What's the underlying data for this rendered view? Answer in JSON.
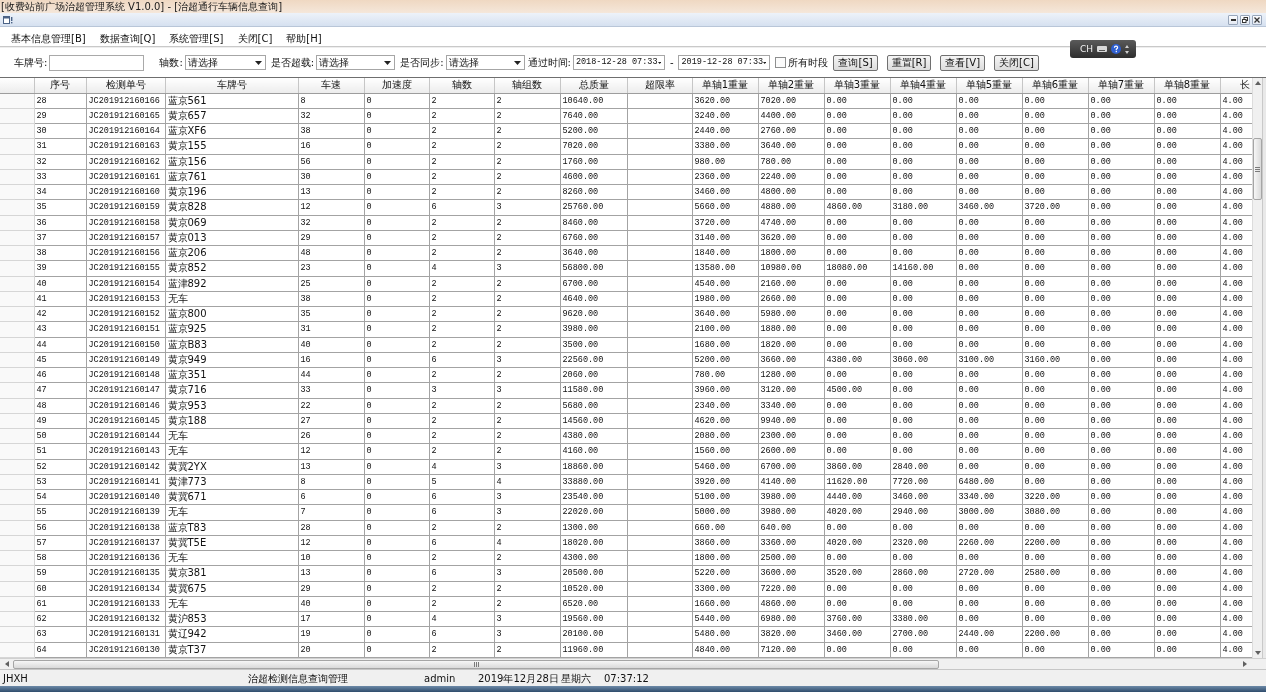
{
  "window": {
    "title": "[收费站前广场治超管理系统 V1.0.0] - [治超通行车辆信息查询]"
  },
  "menu": [
    "基本信息管理[B]",
    "数据查询[Q]",
    "系统管理[S]",
    "关闭[C]",
    "帮助[H]"
  ],
  "filters": {
    "plate_number": {
      "label": "车牌号:"
    },
    "dropdowns": [
      {
        "label": "轴数:",
        "value": "请选择"
      },
      {
        "label": "是否超载:",
        "value": "请选择"
      },
      {
        "label": "是否同步:",
        "value": "请选择"
      }
    ],
    "pass_time": {
      "label": "通过时间:",
      "from": "2018-12-28 07:33",
      "separator": "-",
      "to": "2019-12-28 07:33"
    },
    "all_periods": {
      "label": "所有时段",
      "checked": false
    },
    "buttons": [
      "查询[S]",
      "重置[R]",
      "查看[V]",
      "关闭[C]"
    ]
  },
  "language_bar": {
    "label": "CH"
  },
  "table": {
    "columns": [
      "序号",
      "检测单号",
      "车牌号",
      "车速",
      "加速度",
      "轴数",
      "轴组数",
      "总质量",
      "超限率",
      "单轴1重量",
      "单轴2重量",
      "单轴3重量",
      "单轴4重量",
      "单轴5重量",
      "单轴6重量",
      "单轴7重量",
      "单轴8重量",
      "长"
    ],
    "rows": [
      {
        "no": "28",
        "code": "JC201912160166",
        "plate": "蓝京561",
        "speed": "8",
        "accel": "0",
        "axles": "2",
        "axle_groups": "2",
        "total": "10640.00",
        "axle_weights": [
          "3620.00",
          "7020.00",
          "0.00",
          "0.00",
          "0.00",
          "0.00",
          "0.00",
          "0.00"
        ],
        "length": "4.00"
      },
      {
        "no": "29",
        "code": "JC201912160165",
        "plate": "黄京657",
        "speed": "32",
        "accel": "0",
        "axles": "2",
        "axle_groups": "2",
        "total": "7640.00",
        "axle_weights": [
          "3240.00",
          "4400.00",
          "0.00",
          "0.00",
          "0.00",
          "0.00",
          "0.00",
          "0.00"
        ],
        "length": "4.00"
      },
      {
        "no": "30",
        "code": "JC201912160164",
        "plate": "蓝京XF6",
        "speed": "38",
        "accel": "0",
        "axles": "2",
        "axle_groups": "2",
        "total": "5200.00",
        "axle_weights": [
          "2440.00",
          "2760.00",
          "0.00",
          "0.00",
          "0.00",
          "0.00",
          "0.00",
          "0.00"
        ],
        "length": "4.00"
      },
      {
        "no": "31",
        "code": "JC201912160163",
        "plate": "黄京155",
        "speed": "16",
        "accel": "0",
        "axles": "2",
        "axle_groups": "2",
        "total": "7020.00",
        "axle_weights": [
          "3380.00",
          "3640.00",
          "0.00",
          "0.00",
          "0.00",
          "0.00",
          "0.00",
          "0.00"
        ],
        "length": "4.00"
      },
      {
        "no": "32",
        "code": "JC201912160162",
        "plate": "蓝京156",
        "speed": "56",
        "accel": "0",
        "axles": "2",
        "axle_groups": "2",
        "total": "1760.00",
        "axle_weights": [
          "980.00",
          "780.00",
          "0.00",
          "0.00",
          "0.00",
          "0.00",
          "0.00",
          "0.00"
        ],
        "length": "4.00"
      },
      {
        "no": "33",
        "code": "JC201912160161",
        "plate": "蓝京761",
        "speed": "30",
        "accel": "0",
        "axles": "2",
        "axle_groups": "2",
        "total": "4600.00",
        "axle_weights": [
          "2360.00",
          "2240.00",
          "0.00",
          "0.00",
          "0.00",
          "0.00",
          "0.00",
          "0.00"
        ],
        "length": "4.00"
      },
      {
        "no": "34",
        "code": "JC201912160160",
        "plate": "黄京196",
        "speed": "13",
        "accel": "0",
        "axles": "2",
        "axle_groups": "2",
        "total": "8260.00",
        "axle_weights": [
          "3460.00",
          "4800.00",
          "0.00",
          "0.00",
          "0.00",
          "0.00",
          "0.00",
          "0.00"
        ],
        "length": "4.00"
      },
      {
        "no": "35",
        "code": "JC201912160159",
        "plate": "黄京828",
        "speed": "12",
        "accel": "0",
        "axles": "6",
        "axle_groups": "3",
        "total": "25760.00",
        "axle_weights": [
          "5660.00",
          "4880.00",
          "4860.00",
          "3180.00",
          "3460.00",
          "3720.00",
          "0.00",
          "0.00"
        ],
        "length": "4.00"
      },
      {
        "no": "36",
        "code": "JC201912160158",
        "plate": "黄京069",
        "speed": "32",
        "accel": "0",
        "axles": "2",
        "axle_groups": "2",
        "total": "8460.00",
        "axle_weights": [
          "3720.00",
          "4740.00",
          "0.00",
          "0.00",
          "0.00",
          "0.00",
          "0.00",
          "0.00"
        ],
        "length": "4.00"
      },
      {
        "no": "37",
        "code": "JC201912160157",
        "plate": "黄京013",
        "speed": "29",
        "accel": "0",
        "axles": "2",
        "axle_groups": "2",
        "total": "6760.00",
        "axle_weights": [
          "3140.00",
          "3620.00",
          "0.00",
          "0.00",
          "0.00",
          "0.00",
          "0.00",
          "0.00"
        ],
        "length": "4.00"
      },
      {
        "no": "38",
        "code": "JC201912160156",
        "plate": "蓝京206",
        "speed": "48",
        "accel": "0",
        "axles": "2",
        "axle_groups": "2",
        "total": "3640.00",
        "axle_weights": [
          "1840.00",
          "1800.00",
          "0.00",
          "0.00",
          "0.00",
          "0.00",
          "0.00",
          "0.00"
        ],
        "length": "4.00"
      },
      {
        "no": "39",
        "code": "JC201912160155",
        "plate": "黄京852",
        "speed": "23",
        "accel": "0",
        "axles": "4",
        "axle_groups": "3",
        "total": "56800.00",
        "axle_weights": [
          "13580.00",
          "10980.00",
          "18080.00",
          "14160.00",
          "0.00",
          "0.00",
          "0.00",
          "0.00"
        ],
        "length": "4.00"
      },
      {
        "no": "40",
        "code": "JC201912160154",
        "plate": "蓝津892",
        "speed": "25",
        "accel": "0",
        "axles": "2",
        "axle_groups": "2",
        "total": "6700.00",
        "axle_weights": [
          "4540.00",
          "2160.00",
          "0.00",
          "0.00",
          "0.00",
          "0.00",
          "0.00",
          "0.00"
        ],
        "length": "4.00"
      },
      {
        "no": "41",
        "code": "JC201912160153",
        "plate": "无车",
        "speed": "38",
        "accel": "0",
        "axles": "2",
        "axle_groups": "2",
        "total": "4640.00",
        "axle_weights": [
          "1980.00",
          "2660.00",
          "0.00",
          "0.00",
          "0.00",
          "0.00",
          "0.00",
          "0.00"
        ],
        "length": "4.00"
      },
      {
        "no": "42",
        "code": "JC201912160152",
        "plate": "蓝京800",
        "speed": "35",
        "accel": "0",
        "axles": "2",
        "axle_groups": "2",
        "total": "9620.00",
        "axle_weights": [
          "3640.00",
          "5980.00",
          "0.00",
          "0.00",
          "0.00",
          "0.00",
          "0.00",
          "0.00"
        ],
        "length": "4.00"
      },
      {
        "no": "43",
        "code": "JC201912160151",
        "plate": "蓝京925",
        "speed": "31",
        "accel": "0",
        "axles": "2",
        "axle_groups": "2",
        "total": "3980.00",
        "axle_weights": [
          "2100.00",
          "1880.00",
          "0.00",
          "0.00",
          "0.00",
          "0.00",
          "0.00",
          "0.00"
        ],
        "length": "4.00"
      },
      {
        "no": "44",
        "code": "JC201912160150",
        "plate": "蓝京B83",
        "speed": "40",
        "accel": "0",
        "axles": "2",
        "axle_groups": "2",
        "total": "3500.00",
        "axle_weights": [
          "1680.00",
          "1820.00",
          "0.00",
          "0.00",
          "0.00",
          "0.00",
          "0.00",
          "0.00"
        ],
        "length": "4.00"
      },
      {
        "no": "45",
        "code": "JC201912160149",
        "plate": "黄京949",
        "speed": "16",
        "accel": "0",
        "axles": "6",
        "axle_groups": "3",
        "total": "22560.00",
        "axle_weights": [
          "5200.00",
          "3660.00",
          "4380.00",
          "3060.00",
          "3100.00",
          "3160.00",
          "0.00",
          "0.00"
        ],
        "length": "4.00"
      },
      {
        "no": "46",
        "code": "JC201912160148",
        "plate": "蓝京351",
        "speed": "44",
        "accel": "0",
        "axles": "2",
        "axle_groups": "2",
        "total": "2060.00",
        "axle_weights": [
          "780.00",
          "1280.00",
          "0.00",
          "0.00",
          "0.00",
          "0.00",
          "0.00",
          "0.00"
        ],
        "length": "4.00"
      },
      {
        "no": "47",
        "code": "JC201912160147",
        "plate": "黄京716",
        "speed": "33",
        "accel": "0",
        "axles": "3",
        "axle_groups": "3",
        "total": "11580.00",
        "axle_weights": [
          "3960.00",
          "3120.00",
          "4500.00",
          "0.00",
          "0.00",
          "0.00",
          "0.00",
          "0.00"
        ],
        "length": "4.00"
      },
      {
        "no": "48",
        "code": "JC201912160146",
        "plate": "黄京953",
        "speed": "22",
        "accel": "0",
        "axles": "2",
        "axle_groups": "2",
        "total": "5680.00",
        "axle_weights": [
          "2340.00",
          "3340.00",
          "0.00",
          "0.00",
          "0.00",
          "0.00",
          "0.00",
          "0.00"
        ],
        "length": "4.00"
      },
      {
        "no": "49",
        "code": "JC201912160145",
        "plate": "黄京188",
        "speed": "27",
        "accel": "0",
        "axles": "2",
        "axle_groups": "2",
        "total": "14560.00",
        "axle_weights": [
          "4620.00",
          "9940.00",
          "0.00",
          "0.00",
          "0.00",
          "0.00",
          "0.00",
          "0.00"
        ],
        "length": "4.00"
      },
      {
        "no": "50",
        "code": "JC201912160144",
        "plate": "无车",
        "speed": "26",
        "accel": "0",
        "axles": "2",
        "axle_groups": "2",
        "total": "4380.00",
        "axle_weights": [
          "2080.00",
          "2300.00",
          "0.00",
          "0.00",
          "0.00",
          "0.00",
          "0.00",
          "0.00"
        ],
        "length": "4.00"
      },
      {
        "no": "51",
        "code": "JC201912160143",
        "plate": "无车",
        "speed": "12",
        "accel": "0",
        "axles": "2",
        "axle_groups": "2",
        "total": "4160.00",
        "axle_weights": [
          "1560.00",
          "2600.00",
          "0.00",
          "0.00",
          "0.00",
          "0.00",
          "0.00",
          "0.00"
        ],
        "length": "4.00"
      },
      {
        "no": "52",
        "code": "JC201912160142",
        "plate": "黄冀2YX",
        "speed": "13",
        "accel": "0",
        "axles": "4",
        "axle_groups": "3",
        "total": "18860.00",
        "axle_weights": [
          "5460.00",
          "6700.00",
          "3860.00",
          "2840.00",
          "0.00",
          "0.00",
          "0.00",
          "0.00"
        ],
        "length": "4.00"
      },
      {
        "no": "53",
        "code": "JC201912160141",
        "plate": "黄津773",
        "speed": "8",
        "accel": "0",
        "axles": "5",
        "axle_groups": "4",
        "total": "33880.00",
        "axle_weights": [
          "3920.00",
          "4140.00",
          "11620.00",
          "7720.00",
          "6480.00",
          "0.00",
          "0.00",
          "0.00"
        ],
        "length": "4.00"
      },
      {
        "no": "54",
        "code": "JC201912160140",
        "plate": "黄冀671",
        "speed": "6",
        "accel": "0",
        "axles": "6",
        "axle_groups": "3",
        "total": "23540.00",
        "axle_weights": [
          "5100.00",
          "3980.00",
          "4440.00",
          "3460.00",
          "3340.00",
          "3220.00",
          "0.00",
          "0.00"
        ],
        "length": "4.00"
      },
      {
        "no": "55",
        "code": "JC201912160139",
        "plate": "无车",
        "speed": "7",
        "accel": "0",
        "axles": "6",
        "axle_groups": "3",
        "total": "22020.00",
        "axle_weights": [
          "5000.00",
          "3980.00",
          "4020.00",
          "2940.00",
          "3000.00",
          "3080.00",
          "0.00",
          "0.00"
        ],
        "length": "4.00"
      },
      {
        "no": "56",
        "code": "JC201912160138",
        "plate": "蓝京T83",
        "speed": "28",
        "accel": "0",
        "axles": "2",
        "axle_groups": "2",
        "total": "1300.00",
        "axle_weights": [
          "660.00",
          "640.00",
          "0.00",
          "0.00",
          "0.00",
          "0.00",
          "0.00",
          "0.00"
        ],
        "length": "4.00"
      },
      {
        "no": "57",
        "code": "JC201912160137",
        "plate": "黄冀T5E",
        "speed": "12",
        "accel": "0",
        "axles": "6",
        "axle_groups": "4",
        "total": "18020.00",
        "axle_weights": [
          "3860.00",
          "3360.00",
          "4020.00",
          "2320.00",
          "2260.00",
          "2200.00",
          "0.00",
          "0.00"
        ],
        "length": "4.00"
      },
      {
        "no": "58",
        "code": "JC201912160136",
        "plate": "无车",
        "speed": "10",
        "accel": "0",
        "axles": "2",
        "axle_groups": "2",
        "total": "4300.00",
        "axle_weights": [
          "1800.00",
          "2500.00",
          "0.00",
          "0.00",
          "0.00",
          "0.00",
          "0.00",
          "0.00"
        ],
        "length": "4.00"
      },
      {
        "no": "59",
        "code": "JC201912160135",
        "plate": "黄京381",
        "speed": "13",
        "accel": "0",
        "axles": "6",
        "axle_groups": "3",
        "total": "20500.00",
        "axle_weights": [
          "5220.00",
          "3600.00",
          "3520.00",
          "2860.00",
          "2720.00",
          "2580.00",
          "0.00",
          "0.00"
        ],
        "length": "4.00"
      },
      {
        "no": "60",
        "code": "JC201912160134",
        "plate": "黄冀675",
        "speed": "29",
        "accel": "0",
        "axles": "2",
        "axle_groups": "2",
        "total": "10520.00",
        "axle_weights": [
          "3300.00",
          "7220.00",
          "0.00",
          "0.00",
          "0.00",
          "0.00",
          "0.00",
          "0.00"
        ],
        "length": "4.00"
      },
      {
        "no": "61",
        "code": "JC201912160133",
        "plate": "无车",
        "speed": "40",
        "accel": "0",
        "axles": "2",
        "axle_groups": "2",
        "total": "6520.00",
        "axle_weights": [
          "1660.00",
          "4860.00",
          "0.00",
          "0.00",
          "0.00",
          "0.00",
          "0.00",
          "0.00"
        ],
        "length": "4.00"
      },
      {
        "no": "62",
        "code": "JC201912160132",
        "plate": "黄沪853",
        "speed": "17",
        "accel": "0",
        "axles": "4",
        "axle_groups": "3",
        "total": "19560.00",
        "axle_weights": [
          "5440.00",
          "6980.00",
          "3760.00",
          "3380.00",
          "0.00",
          "0.00",
          "0.00",
          "0.00"
        ],
        "length": "4.00"
      },
      {
        "no": "63",
        "code": "JC201912160131",
        "plate": "黄辽942",
        "speed": "19",
        "accel": "0",
        "axles": "6",
        "axle_groups": "3",
        "total": "20100.00",
        "axle_weights": [
          "5480.00",
          "3820.00",
          "3460.00",
          "2700.00",
          "2440.00",
          "2200.00",
          "0.00",
          "0.00"
        ],
        "length": "4.00"
      },
      {
        "no": "64",
        "code": "JC201912160130",
        "plate": "黄京T37",
        "speed": "20",
        "accel": "0",
        "axles": "2",
        "axle_groups": "2",
        "total": "11960.00",
        "axle_weights": [
          "4840.00",
          "7120.00",
          "0.00",
          "0.00",
          "0.00",
          "0.00",
          "0.00",
          "0.00"
        ],
        "length": "4.00"
      }
    ]
  },
  "status_bar": [
    "JHXH",
    "治超检测信息查询管理",
    "admin",
    "2019年12月28日",
    "星期六",
    "07:37:12"
  ]
}
